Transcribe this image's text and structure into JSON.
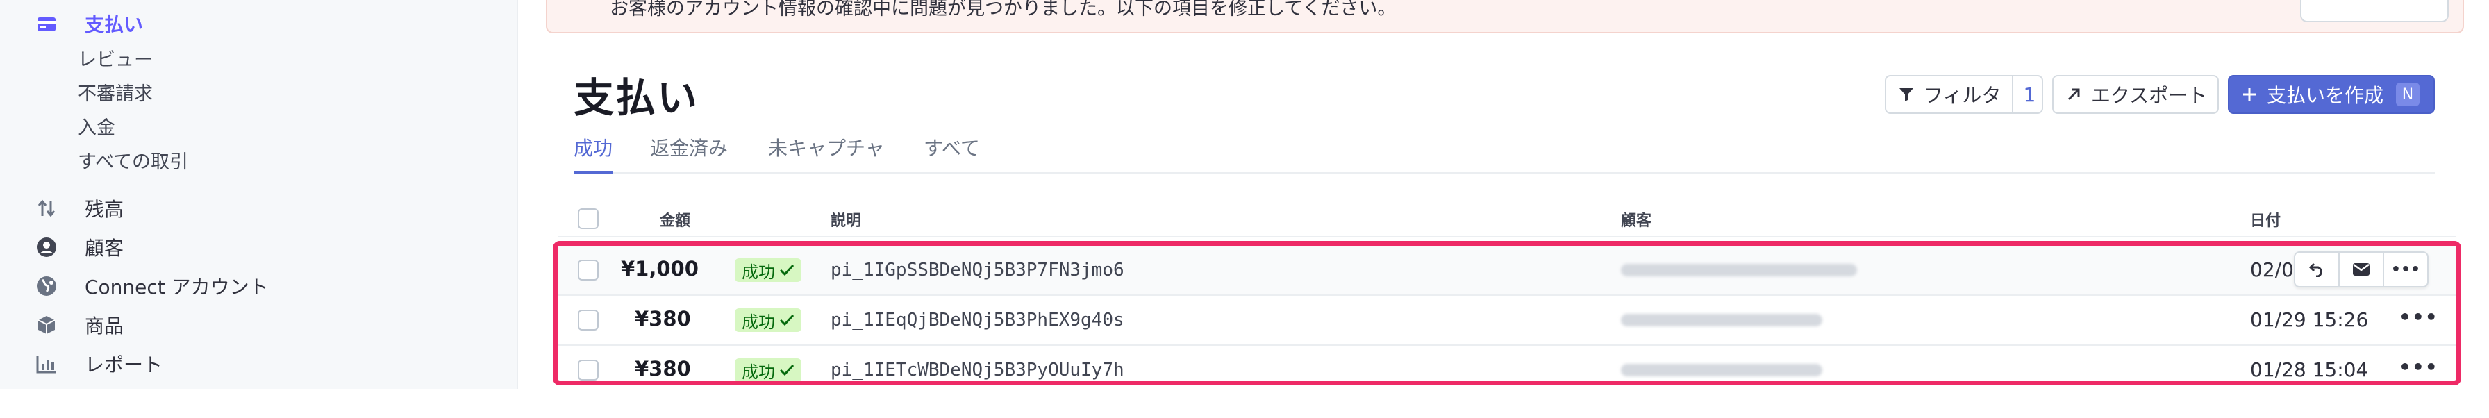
{
  "sidebar": {
    "payments": {
      "label": "支払い",
      "icon": "payments-icon"
    },
    "sub_items": [
      "レビュー",
      "不審請求",
      "入金",
      "すべての取引"
    ],
    "main_items": [
      {
        "label": "残高",
        "icon": "balance-arrows-icon"
      },
      {
        "label": "顧客",
        "icon": "customer-icon"
      },
      {
        "label": "Connect アカウント",
        "icon": "globe-icon"
      },
      {
        "label": "商品",
        "icon": "box-icon"
      },
      {
        "label": "レポート",
        "icon": "report-chart-icon"
      }
    ]
  },
  "banner": {
    "text": "お客様のアカウント情報の確認中に問題が見つかりました。以下の項目を修正してください。"
  },
  "page": {
    "title": "支払い"
  },
  "toolbar": {
    "filter_label": "フィルタ",
    "filter_count": "1",
    "export_label": "エクスポート",
    "create_label": "支払いを作成",
    "create_shortcut": "N"
  },
  "tabs": [
    "成功",
    "返金済み",
    "未キャプチャ",
    "すべて"
  ],
  "table": {
    "headers": {
      "amount": "金額",
      "description": "説明",
      "customer": "顧客",
      "date": "日付"
    },
    "rows": [
      {
        "amount": "¥1,000",
        "status": "成功",
        "description": "pi_1IGpSSBDeNQj5B3P7FN3jmo6",
        "date": "02/0"
      },
      {
        "amount": "¥380",
        "status": "成功",
        "description": "pi_1IEqQjBDeNQj5B3PhEX9g40s",
        "date": "01/29 15:26"
      },
      {
        "amount": "¥380",
        "status": "成功",
        "description": "pi_1IETcWBDeNQj5B3PyOUuIy7h",
        "date": "01/28 15:04"
      }
    ],
    "more_label": "•••"
  },
  "colors": {
    "accent": "#5469d4",
    "highlight": "#ee2a66",
    "success_bg": "#d7f7c2",
    "success_text": "#05690d"
  }
}
